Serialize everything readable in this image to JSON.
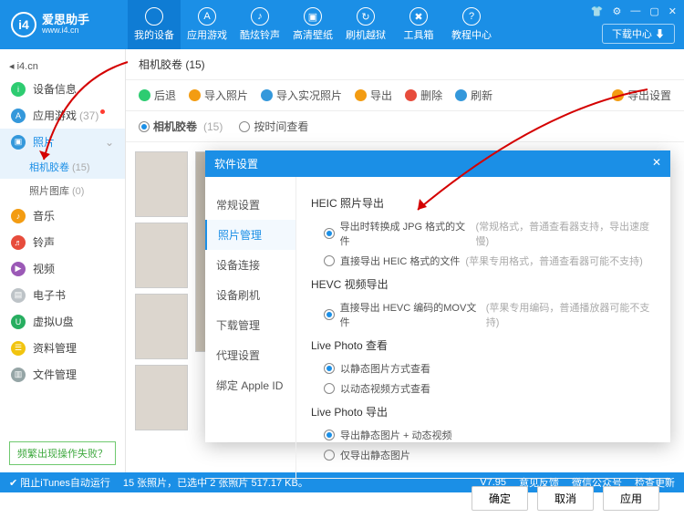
{
  "header": {
    "logo_letter": "i4",
    "logo_cn": "爱思助手",
    "logo_url": "www.i4.cn",
    "nav": [
      {
        "label": "我的设备"
      },
      {
        "label": "应用游戏"
      },
      {
        "label": "酷炫铃声"
      },
      {
        "label": "高清壁纸"
      },
      {
        "label": "刷机越狱"
      },
      {
        "label": "工具箱"
      },
      {
        "label": "教程中心"
      }
    ],
    "download": "下载中心"
  },
  "sidebar": {
    "crumb": "i4.cn",
    "items": [
      {
        "label": "设备信息",
        "color": "#2ecc71"
      },
      {
        "label": "应用游戏",
        "count": "(37)",
        "dot": true,
        "color": "#3498db"
      },
      {
        "label": "照片",
        "active": true,
        "color": "#3498db"
      },
      {
        "label": "音乐",
        "color": "#f39c12"
      },
      {
        "label": "铃声",
        "color": "#e74c3c"
      },
      {
        "label": "视频",
        "color": "#9b59b6"
      },
      {
        "label": "电子书",
        "color": "#bdc3c7"
      },
      {
        "label": "虚拟U盘",
        "color": "#27ae60"
      },
      {
        "label": "资料管理",
        "color": "#f1c40f"
      },
      {
        "label": "文件管理",
        "color": "#95a5a6"
      }
    ],
    "sub": [
      {
        "label": "相机胶卷",
        "count": "(15)",
        "active": true
      },
      {
        "label": "照片图库",
        "count": "(0)"
      }
    ],
    "help": "频繁出现操作失败？"
  },
  "main": {
    "title": "相机胶卷 (15)",
    "toolbar": {
      "back": "后退",
      "import": "导入照片",
      "import_live": "导入实况照片",
      "export": "导出",
      "delete": "删除",
      "refresh": "刷新",
      "settings": "导出设置"
    },
    "subbar": {
      "opt1": "相机胶卷",
      "opt1_count": "(15)",
      "opt2": "按时间查看"
    }
  },
  "modal": {
    "title": "软件设置",
    "side": [
      "常规设置",
      "照片管理",
      "设备连接",
      "设备刷机",
      "下载管理",
      "代理设置",
      "绑定 Apple ID"
    ],
    "side_active": 1,
    "sections": {
      "heic_title": "HEIC 照片导出",
      "heic_opt1": "导出时转换成 JPG 格式的文件",
      "heic_hint1": "(常规格式，普通查看器支持，导出速度慢)",
      "heic_opt2": "直接导出 HEIC 格式的文件",
      "heic_hint2": "(苹果专用格式，普通查看器可能不支持)",
      "hevc_title": "HEVC 视频导出",
      "hevc_opt1": "直接导出 HEVC 编码的MOV文件",
      "hevc_hint1": "(苹果专用编码，普通播放器可能不支持)",
      "live_view_title": "Live Photo 查看",
      "live_view_opt1": "以静态图片方式查看",
      "live_view_opt2": "以动态视频方式查看",
      "live_exp_title": "Live Photo 导出",
      "live_exp_opt1": "导出静态图片 + 动态视频",
      "live_exp_opt2": "仅导出静态图片"
    },
    "buttons": {
      "ok": "确定",
      "cancel": "取消",
      "apply": "应用"
    }
  },
  "status": {
    "itunes": "阻止iTunes自动运行",
    "info": "15 张照片，已选中 2 张照片 517.17 KB。",
    "version": "V7.95",
    "feedback": "意见反馈",
    "wechat": "微信公众号",
    "update": "检查更新"
  }
}
